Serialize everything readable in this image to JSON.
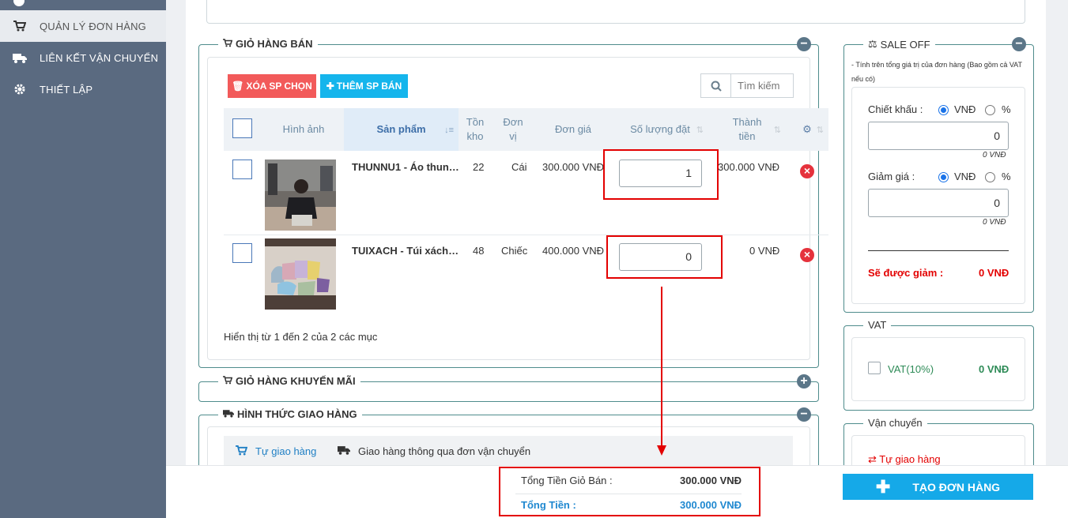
{
  "sidebar": {
    "items": [
      {
        "label": "QUẢN LÝ ĐƠN HÀNG",
        "icon": "cart-icon"
      },
      {
        "label": "LIÊN KẾT VẬN CHUYỂN",
        "icon": "truck-icon"
      },
      {
        "label": "THIẾT LẬP",
        "icon": "gear-icon"
      }
    ]
  },
  "cart": {
    "title": "GIỎ HÀNG BÁN",
    "delete_selected": "XÓA SP CHỌN",
    "add_product": "THÊM SP BÁN",
    "search_placeholder": "Tìm kiếm",
    "columns": {
      "image": "Hình ảnh",
      "product": "Sản phẩm",
      "stock_1": "Tồn",
      "stock_2": "kho",
      "unit_1": "Đơn",
      "unit_2": "vị",
      "price": "Đơn giá",
      "qty": "Số lượng đặt",
      "total_1": "Thành",
      "total_2": "tiền"
    },
    "rows": [
      {
        "product": "THUNNU1 - Áo thun…",
        "stock": "22",
        "unit": "Cái",
        "price": "300.000 VNĐ",
        "qty": "1",
        "total": "300.000 VNĐ"
      },
      {
        "product": "TUIXACH - Túi xách…",
        "stock": "48",
        "unit": "Chiếc",
        "price": "400.000 VNĐ",
        "qty": "0",
        "total": "0 VNĐ"
      }
    ],
    "pagination": "Hiển thị từ 1 đến 2 của 2 các mục"
  },
  "promo_cart": {
    "title": "GIỎ HÀNG KHUYẾN MÃI"
  },
  "shipping_method": {
    "title": "HÌNH THỨC GIAO HÀNG",
    "tabs": [
      "Tự giao hàng",
      "Giao hàng thông qua đơn vận chuyển"
    ]
  },
  "sale_off": {
    "title": "SALE OFF",
    "note_1": "- Tính trên tổng giá trị của đơn hàng (Bao gồm cả VAT",
    "note_2": "nếu có)",
    "discount_label": "Chiết khấu :",
    "discount_value": "0",
    "discount_hint": "0 VNĐ",
    "reduce_label": "Giảm giá :",
    "reduce_value": "0",
    "reduce_hint": "0 VNĐ",
    "opt_vnd": "VNĐ",
    "opt_pct": "%",
    "result_label": "Sẽ được giảm :",
    "result_value": "0 VNĐ"
  },
  "vat": {
    "title": "VAT",
    "label": "VAT(10%)",
    "value": "0 VNĐ"
  },
  "delivery": {
    "title": "Vận chuyển",
    "option": "Tự giao hàng"
  },
  "summary": {
    "cart_total_label": "Tổng Tiền Giỏ Bán :",
    "cart_total_value": "300.000 VNĐ",
    "total_label": "Tổng Tiền :",
    "total_value": "300.000 VNĐ"
  },
  "create_order": "TẠO ĐƠN HÀNG",
  "colors": {
    "accent": "#15a9e8",
    "danger": "#e30000",
    "sidebar": "#5a6a80",
    "panel_border": "#4f8c8c"
  }
}
